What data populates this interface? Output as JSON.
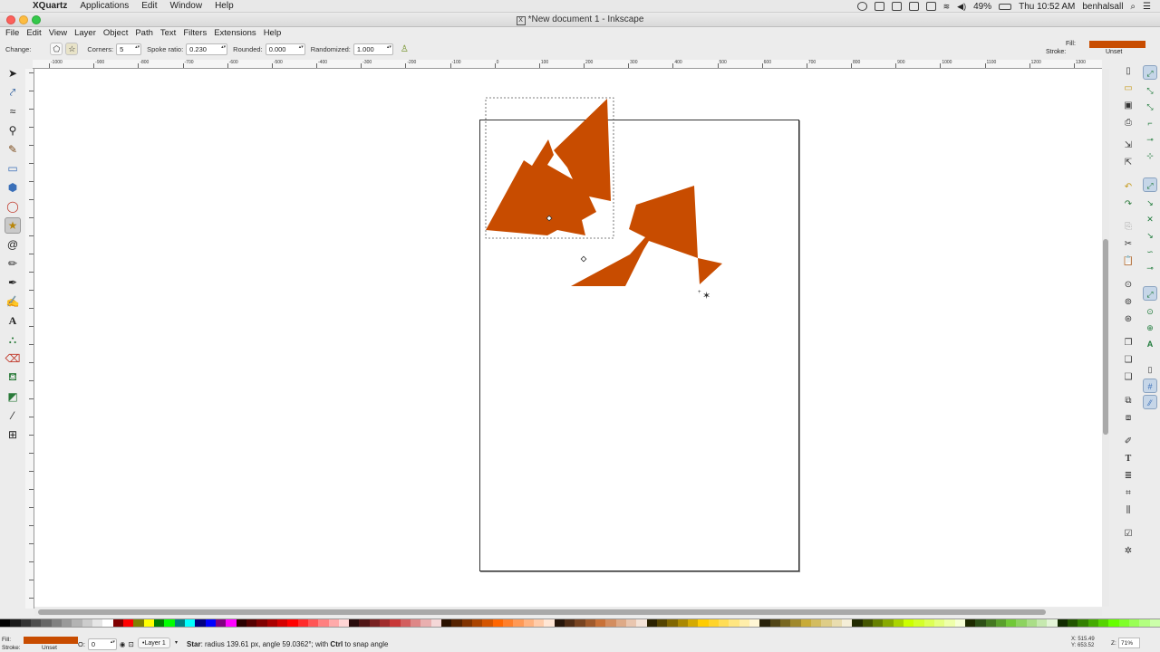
{
  "menubar": {
    "app_name": "XQuartz",
    "items": [
      "Applications",
      "Edit",
      "Window",
      "Help"
    ],
    "battery": "49%",
    "clock": "Thu 10:52 AM",
    "user": "benhalsall"
  },
  "window": {
    "title": "*New document 1 - Inkscape"
  },
  "app_menu": [
    "File",
    "Edit",
    "View",
    "Layer",
    "Object",
    "Path",
    "Text",
    "Filters",
    "Extensions",
    "Help"
  ],
  "tool_controls": {
    "change_label": "Change:",
    "corners_label": "Corners:",
    "corners_value": "5",
    "spoke_label": "Spoke ratio:",
    "spoke_value": "0.230",
    "rounded_label": "Rounded:",
    "rounded_value": "0.000",
    "randomized_label": "Randomized:",
    "randomized_value": "1.000",
    "fill_label": "Fill:",
    "stroke_label": "Stroke:",
    "stroke_value": "Unset"
  },
  "ruler_top_labels": [
    "-1000",
    "-900",
    "-800",
    "-700",
    "-600",
    "-500",
    "-400",
    "-300",
    "-200",
    "-100",
    "0",
    "100",
    "200",
    "300",
    "400",
    "500",
    "600",
    "700",
    "800",
    "900",
    "1000",
    "1100",
    "1200",
    "1300"
  ],
  "toolbox": [
    "selector-tool",
    "node-tool",
    "tweak-tool",
    "zoom-tool",
    "measure-tool",
    "rect-tool",
    "3dbox-tool",
    "ellipse-tool",
    "star-tool",
    "spiral-tool",
    "pencil-tool",
    "pen-tool",
    "calligraphy-tool",
    "text-tool",
    "spray-tool",
    "eraser-tool",
    "bucket-tool",
    "gradient-tool",
    "dropper-tool",
    "connector-tool"
  ],
  "colors": {
    "fill": "#c84c00",
    "page_border": "#333333"
  },
  "palette": [
    "#000000",
    "#1a1a1a",
    "#333333",
    "#4d4d4d",
    "#666666",
    "#808080",
    "#999999",
    "#b3b3b3",
    "#cccccc",
    "#e6e6e6",
    "#ffffff",
    "#800000",
    "#ff0000",
    "#808000",
    "#ffff00",
    "#008000",
    "#00ff00",
    "#008080",
    "#00ffff",
    "#000080",
    "#0000ff",
    "#800080",
    "#ff00ff",
    "#2b0000",
    "#550000",
    "#800000",
    "#aa0000",
    "#d40000",
    "#ff0000",
    "#ff2a2a",
    "#ff5555",
    "#ff8080",
    "#ffaaaa",
    "#ffd5d5",
    "#280b0b",
    "#501616",
    "#782121",
    "#a02c2c",
    "#c83737",
    "#d35f5f",
    "#de8787",
    "#e9afaf",
    "#f4d7d7",
    "#2b1100",
    "#552200",
    "#803300",
    "#aa4400",
    "#d45500",
    "#ff6600",
    "#ff7f2a",
    "#ff9955",
    "#ffb380",
    "#ffccaa",
    "#ffe6d5",
    "#28170b",
    "#502d16",
    "#784421",
    "#a05a2c",
    "#c87137",
    "#d38d5f",
    "#deaa87",
    "#e9c6af",
    "#f4e3d7",
    "#2b2200",
    "#554400",
    "#806600",
    "#aa8800",
    "#d4aa00",
    "#ffcc00",
    "#ffd42a",
    "#ffdd55",
    "#ffe680",
    "#ffeeaa",
    "#fff6d5",
    "#28220b",
    "#504416",
    "#786721",
    "#a0892c",
    "#c8ab37",
    "#d3bc5f",
    "#decd87",
    "#e9ddaf",
    "#f4eed7",
    "#222b00",
    "#445500",
    "#668000",
    "#88aa00",
    "#aad400",
    "#ccff00",
    "#d4ff2a",
    "#ddff55",
    "#e5ff80",
    "#eeffaa",
    "#f6ffd5",
    "#1e2b00",
    "#2d5016",
    "#447821",
    "#5aa02c",
    "#71c837",
    "#8dd35f",
    "#aade87",
    "#c6e9af",
    "#e3f4d7",
    "#112b00",
    "#225500",
    "#338000",
    "#44aa00",
    "#55d400",
    "#66ff00",
    "#7fff2a",
    "#99ff55",
    "#b3ff80",
    "#ccffaa"
  ],
  "status": {
    "fill_label": "Fill:",
    "stroke_label": "Stroke:",
    "stroke_value": "Unset",
    "opacity_label": "O:",
    "opacity_value": "0",
    "layer": "•Layer 1",
    "message_bold": "Star",
    "message_rest": ": radius 139.61 px, angle 59.0362°; with ",
    "message_key": "Ctrl",
    "message_end": " to snap angle",
    "coord_x": "X: 515.49",
    "coord_y": "Y: 653.52",
    "zoom_label": "Z:",
    "zoom_value": "71%"
  }
}
